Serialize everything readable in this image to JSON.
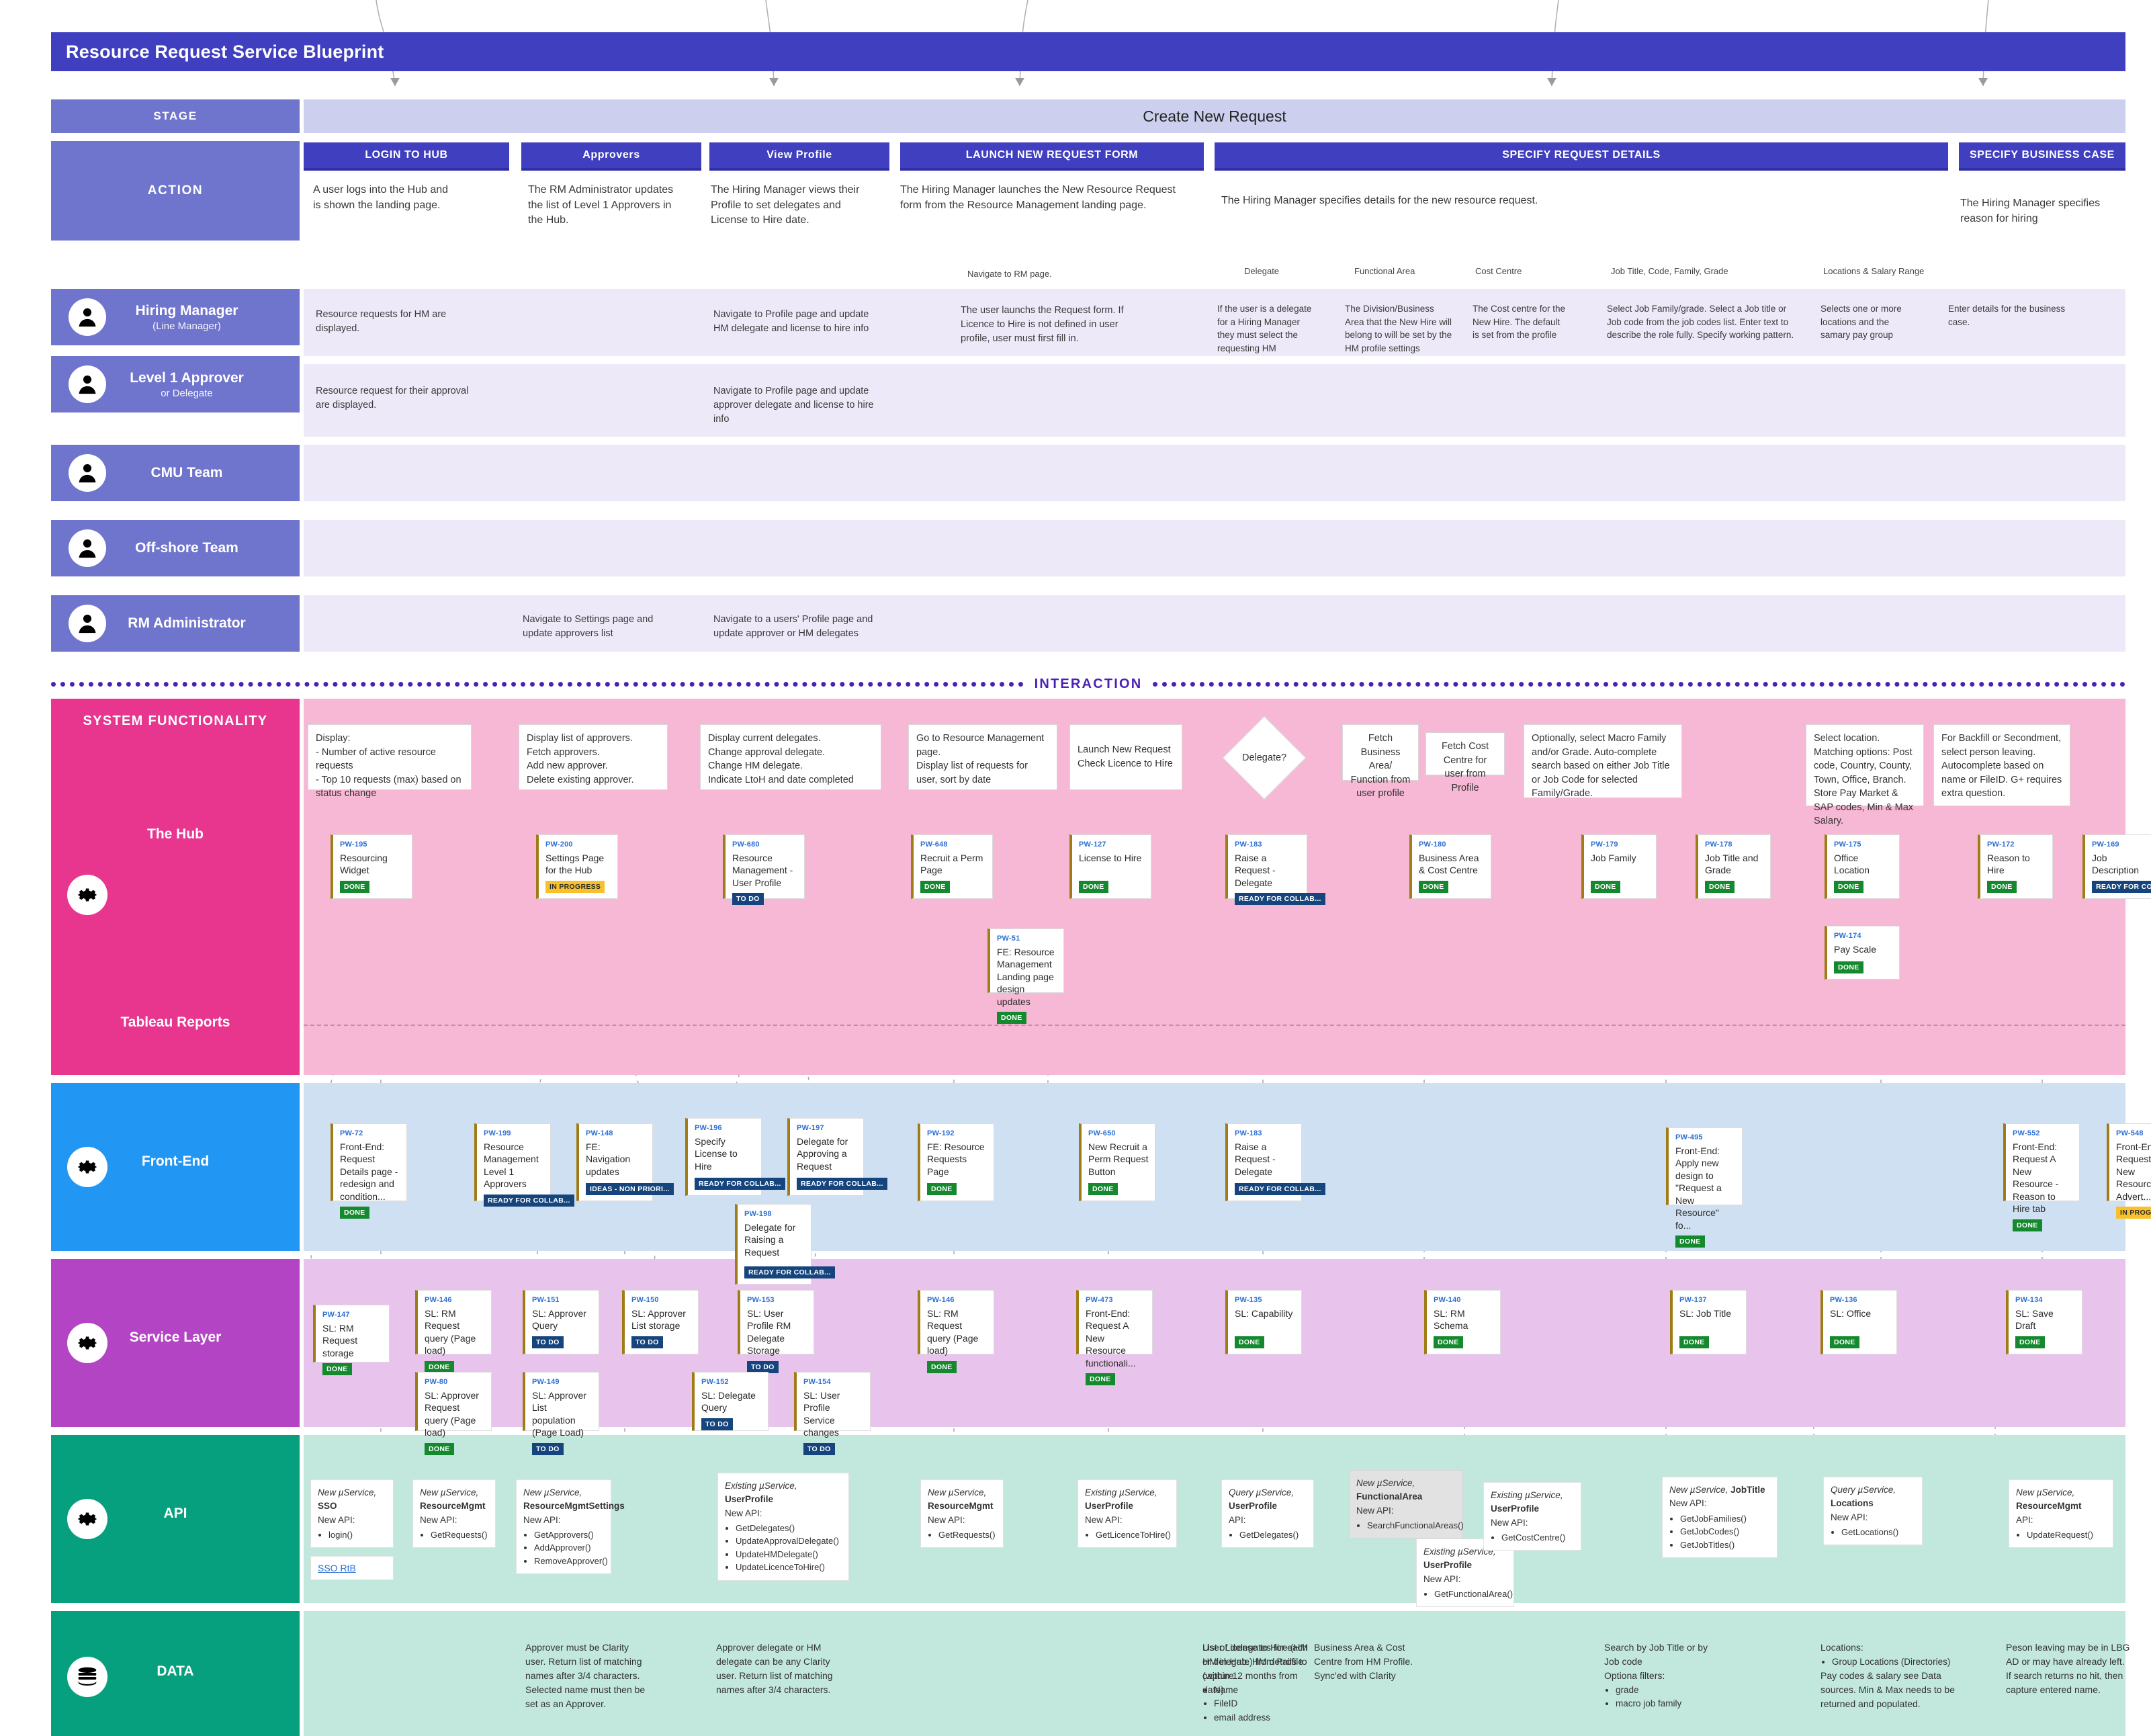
{
  "title": "Resource Request Service Blueprint",
  "left_labels": {
    "stage": "STAGE",
    "action": "ACTION",
    "interaction": "INTERACTION",
    "system_functionality": "SYSTEM FUNCTIONALITY",
    "the_hub": "The Hub",
    "tableau_reports": "Tableau Reports",
    "front_end": "Front-End",
    "service_layer": "Service Layer",
    "api": "API",
    "data": "DATA"
  },
  "roles": [
    {
      "name": "Hiring Manager",
      "sub": "(Line Manager)"
    },
    {
      "name": "Level 1 Approver",
      "sub": "or Delegate"
    },
    {
      "name": "CMU Team",
      "sub": ""
    },
    {
      "name": "Off-shore Team",
      "sub": ""
    },
    {
      "name": "RM Administrator",
      "sub": ""
    }
  ],
  "stage": {
    "label": "Create New Request"
  },
  "action_steps": [
    {
      "title": "LOGIN TO HUB",
      "text": "A user logs into the Hub and is shown the landing page."
    },
    {
      "title": "Approvers",
      "text": "The RM Administrator updates the list of Level 1 Approvers in the Hub."
    },
    {
      "title": "View Profile",
      "text": "The Hiring Manager views their Profile to set delegates and License to Hire date."
    },
    {
      "title": "LAUNCH NEW REQUEST FORM",
      "text": "The Hiring Manager launches the New Resource Request  form from the Resource Management landing page."
    },
    {
      "title": "SPECIFY REQUEST DETAILS",
      "text": "The Hiring Manager specifies details for the new resource request."
    },
    {
      "title": "SPECIFY BUSINESS CASE",
      "text": "The Hiring Manager specifies reason for hiring"
    }
  ],
  "action_sub_note": "Navigate to RM page.",
  "action_field_labels": [
    "Delegate",
    "Functional Area",
    "Cost Centre",
    "Job Title, Code, Family, Grade",
    "Locations & Salary Range"
  ],
  "hiring_manager_row": [
    "Resource requests for HM are displayed.",
    "Navigate to Profile page and update HM delegate and license to hire info",
    "The user launchs the Request form. If Licence to Hire is not defined in user profile, user must first fill in.",
    "If the user is a delegate for a Hiring Manager they must select the requesting HM",
    "The Division/Business Area that the New Hire will belong to will be set by the HM profile settings",
    "The Cost centre for the New Hire. The default is set from the profile",
    "Select Job Family/grade. Select a Job title or Job code from the job codes list. Enter text to describe the role fully. Specify working pattern.",
    "Selects one or more locations and the samary pay group",
    "Enter details for the business case."
  ],
  "level1_row": [
    "Resource request for their approval are displayed.",
    "Navigate to Profile page and update approver delegate and license to hire info"
  ],
  "rm_admin_row": [
    "Navigate to Settings page and update approvers list",
    "Navigate to a users' Profile page and update approver or HM delegates"
  ],
  "system_functionality_notes": [
    "Display:\n- Number of active resource requests\n- Top 10 requests (max) based on status change",
    "Display list of approvers.\nFetch approvers.\nAdd new approver.\nDelete existing approver.",
    "Display current delegates.\nChange approval delegate.\nChange HM delegate.\nIndicate LtoH and date completed",
    "Go to Resource Management page.\nDisplay list of requests for user, sort by date",
    "Launch New Request\nCheck Licence to Hire",
    "Fetch Business Area/ Function from user profile",
    "Fetch Cost Centre for user from Profile",
    "Optionally, select Macro Family and/or Grade. Auto-complete search based on either Job Title or Job Code for selected Family/Grade.",
    "Select location. Matching options: Post code, Country, County, Town, Office, Branch. Store Pay Market & SAP codes, Min & Max Salary.",
    "For Backfill or Secondment, select person leaving. Autocomplete based on name or FileID. G+ requires extra question."
  ],
  "decision": {
    "label": "Delegate?"
  },
  "hub_cards": [
    {
      "key": "PW-195",
      "title": "Resourcing Widget",
      "status": "DONE",
      "cls": "done"
    },
    {
      "key": "PW-200",
      "title": "Settings Page for the Hub",
      "status": "IN PROGRESS",
      "cls": "prog"
    },
    {
      "key": "PW-680",
      "title": "Resource Management - User Profile",
      "status": "TO DO",
      "cls": "todo"
    },
    {
      "key": "PW-648",
      "title": "Recruit a Perm Page",
      "status": "DONE",
      "cls": "done"
    },
    {
      "key": "PW-127",
      "title": "License to Hire",
      "status": "DONE",
      "cls": "done"
    },
    {
      "key": "PW-183",
      "title": "Raise a Request - Delegate",
      "status": "READY FOR COLLAB...",
      "cls": "ready"
    },
    {
      "key": "PW-180",
      "title": "Business Area & Cost Centre",
      "status": "DONE",
      "cls": "done"
    },
    {
      "key": "PW-179",
      "title": "Job Family",
      "status": "DONE",
      "cls": "done"
    },
    {
      "key": "PW-178",
      "title": "Job Title and Grade",
      "status": "DONE",
      "cls": "done"
    },
    {
      "key": "PW-175",
      "title": "Office Location",
      "status": "DONE",
      "cls": "done"
    },
    {
      "key": "PW-172",
      "title": "Reason to Hire",
      "status": "DONE",
      "cls": "done"
    },
    {
      "key": "PW-169",
      "title": "Job Description",
      "status": "READY FOR COLLAB...",
      "cls": "ready"
    }
  ],
  "hub_cards_row2": [
    {
      "key": "PW-51",
      "title": "FE: Resource Management Landing page design updates",
      "status": "DONE",
      "cls": "done"
    },
    {
      "key": "PW-174",
      "title": "Pay Scale",
      "status": "DONE",
      "cls": "done"
    }
  ],
  "frontend_cards": [
    {
      "key": "PW-72",
      "title": "Front-End: Request Details page - redesign and condition...",
      "status": "DONE",
      "cls": "done"
    },
    {
      "key": "PW-199",
      "title": "Resource Management Level 1 Approvers",
      "status": "READY FOR COLLAB...",
      "cls": "ready"
    },
    {
      "key": "PW-148",
      "title": "FE: Navigation updates",
      "status": "IDEAS - NON PRIORI...",
      "cls": "ideas"
    },
    {
      "key": "PW-196",
      "title": "Specify License to Hire",
      "status": "READY FOR COLLAB...",
      "cls": "ready"
    },
    {
      "key": "PW-197",
      "title": "Delegate for Approving a Request",
      "status": "READY FOR COLLAB...",
      "cls": "ready"
    },
    {
      "key": "PW-192",
      "title": "FE: Resource Requests Page",
      "status": "DONE",
      "cls": "done"
    },
    {
      "key": "PW-650",
      "title": "New Recruit a Perm Request Button",
      "status": "DONE",
      "cls": "done"
    },
    {
      "key": "PW-183",
      "title": "Raise a Request - Delegate",
      "status": "READY FOR COLLAB...",
      "cls": "ready"
    },
    {
      "key": "PW-495",
      "title": "Front-End: Apply new design to \"Request a New Resource\" fo...",
      "status": "DONE",
      "cls": "done"
    },
    {
      "key": "PW-552",
      "title": "Front-End: Request A New Resource - Reason to Hire tab",
      "status": "DONE",
      "cls": "done"
    },
    {
      "key": "PW-548",
      "title": "Front-End: Request A New Resource - Advert...",
      "status": "IN PROGRESS",
      "cls": "prog"
    }
  ],
  "frontend_cards_row2": [
    {
      "key": "PW-198",
      "title": "Delegate for Raising a Request",
      "status": "READY FOR COLLAB...",
      "cls": "ready"
    }
  ],
  "service_cards": [
    {
      "key": "PW-147",
      "title": "SL: RM Request storage",
      "status": "DONE",
      "cls": "done"
    },
    {
      "key": "PW-146",
      "title": "SL: RM Request query (Page load)",
      "status": "DONE",
      "cls": "done"
    },
    {
      "key": "PW-151",
      "title": "SL: Approver Query",
      "status": "TO DO",
      "cls": "todo"
    },
    {
      "key": "PW-150",
      "title": "SL: Approver List storage",
      "status": "TO DO",
      "cls": "todo"
    },
    {
      "key": "PW-153",
      "title": "SL: User Profile RM Delegate Storage",
      "status": "TO DO",
      "cls": "todo"
    },
    {
      "key": "PW-146",
      "title": "SL: RM Request query (Page load)",
      "status": "DONE",
      "cls": "done"
    },
    {
      "key": "PW-473",
      "title": "Front-End: Request A New Resource functionali...",
      "status": "DONE",
      "cls": "done"
    },
    {
      "key": "PW-135",
      "title": "SL: Capability",
      "status": "DONE",
      "cls": "done"
    },
    {
      "key": "PW-140",
      "title": "SL: RM Schema",
      "status": "DONE",
      "cls": "done"
    },
    {
      "key": "PW-137",
      "title": "SL: Job Title",
      "status": "DONE",
      "cls": "done"
    },
    {
      "key": "PW-136",
      "title": "SL: Office",
      "status": "DONE",
      "cls": "done"
    },
    {
      "key": "PW-134",
      "title": "SL: Save Draft",
      "status": "DONE",
      "cls": "done"
    }
  ],
  "service_cards_row2": [
    {
      "key": "PW-80",
      "title": "SL: Approver Request query (Page load)",
      "status": "DONE",
      "cls": "done"
    },
    {
      "key": "PW-149",
      "title": "SL: Approver List population (Page Load)",
      "status": "TO DO",
      "cls": "todo"
    },
    {
      "key": "PW-152",
      "title": "SL: Delegate Query",
      "status": "TO DO",
      "cls": "todo"
    },
    {
      "key": "PW-154",
      "title": "SL: User Profile Service changes",
      "status": "TO DO",
      "cls": "todo"
    }
  ],
  "api_boxes": [
    {
      "lead": "New µService,",
      "name": "SSO",
      "apiLabel": "New API:",
      "methods": [
        "login()"
      ]
    },
    {
      "lead": "New µService,",
      "name": "ResourceMgmt",
      "apiLabel": "New API:",
      "methods": [
        "GetRequests()"
      ]
    },
    {
      "lead": "New µService,",
      "name": "ResourceMgmtSettings",
      "apiLabel": "New API:",
      "methods": [
        "GetApprovers()",
        "AddApprover()",
        "RemoveApprover()"
      ]
    },
    {
      "lead": "Existing µService,",
      "name": "UserProfile",
      "apiLabel": "New API:",
      "methods": [
        "GetDelegates()",
        "UpdateApprovalDelegate()",
        "UpdateHMDelegate()",
        "UpdateLicenceToHire()"
      ],
      "inline": true
    },
    {
      "lead": "New µService,",
      "name": "ResourceMgmt",
      "apiLabel": "New API:",
      "methods": [
        "GetRequests()"
      ]
    },
    {
      "lead": "Existing µService,",
      "name": "UserProfile",
      "apiLabel": "New API:",
      "methods": [
        "GetLicenceToHire()"
      ]
    },
    {
      "lead": "Query µService,",
      "name": "UserProfile",
      "apiLabel": "API:",
      "methods": [
        "GetDelegates()"
      ]
    },
    {
      "lead": "New µService,",
      "name": "FunctionalArea",
      "apiLabel": "New API:",
      "methods": [
        "SearchFunctionalAreas()"
      ],
      "grey": true
    },
    {
      "lead": "Existing µService,",
      "name": "UserProfile",
      "apiLabel": "New API:",
      "methods": [
        "GetFunctionalArea()"
      ]
    },
    {
      "lead": "Existing µService,",
      "name": "UserProfile",
      "apiLabel": "New API:",
      "methods": [
        "GetCostCentre()"
      ]
    },
    {
      "lead": "New µService,",
      "name": "JobTitle",
      "apiLabel": "New API:",
      "methods": [
        "GetJobFamilies()",
        "GetJobCodes()",
        "GetJobTitles()"
      ],
      "inline": true
    },
    {
      "lead": "Query µService,",
      "name": "Locations",
      "apiLabel": "New API:",
      "methods": [
        "GetLocations()"
      ]
    },
    {
      "lead": "New µService,",
      "name": "ResourceMgmt",
      "apiLabel": "API:",
      "methods": [
        "UpdateRequest()"
      ]
    }
  ],
  "sso_link": {
    "label": "SSO RtB"
  },
  "data_notes": [
    {
      "text": "Approver must be Clarity user. Return list of matching names after 3/4 characters. Selected name must then be set as an Approver.",
      "bullets": []
    },
    {
      "text": "Approver delegate or HM delegate can be any Clarity user. Return list of matching names after 3/4 characters.",
      "bullets": []
    },
    {
      "text": "User License to Hire (HM or delegate) from Profile (within 12 months from date)",
      "bullets": []
    },
    {
      "text": "List of delegates for each HM in Hub. HM details to capture:",
      "bullets": [
        "Name",
        "FileID",
        "email address"
      ]
    },
    {
      "text": "Business Area & Cost Centre from HM Profile. Sync'ed with Clarity",
      "bullets": []
    },
    {
      "text": "Search by Job Title or by Job code\nOptiona filters:",
      "bullets": [
        "grade",
        "macro job family"
      ]
    },
    {
      "text": "Locations:",
      "bullets": [
        "Group Locations (Directories)"
      ],
      "after": "Pay codes & salary see Data sources. Min & Max needs to be returned and populated."
    },
    {
      "text": "Peson leaving may be in LBG AD or may have already left. If search returns no hit, then capture entered name.",
      "bullets": []
    }
  ],
  "colors": {
    "title_bar": "#3f3fbf",
    "role_label": "#6f74cd",
    "stage_band": "#ccd0ee",
    "system_functionality": "#e8368f",
    "front_end": "#2196f3",
    "service_layer": "#b345c4",
    "api": "#07a07e",
    "data": "#07a07e",
    "pink_lane": "#f6b8d4",
    "blue_lane": "#cfe0f2",
    "purple_lane": "#e8c4ec",
    "teal_lane": "#c2e8dd",
    "interaction": "#4b21b5",
    "status_done": "#15892e",
    "status_todo": "#16457e",
    "status_in_progress": "#f8c12c",
    "jira_key": "#2d6fd4"
  }
}
